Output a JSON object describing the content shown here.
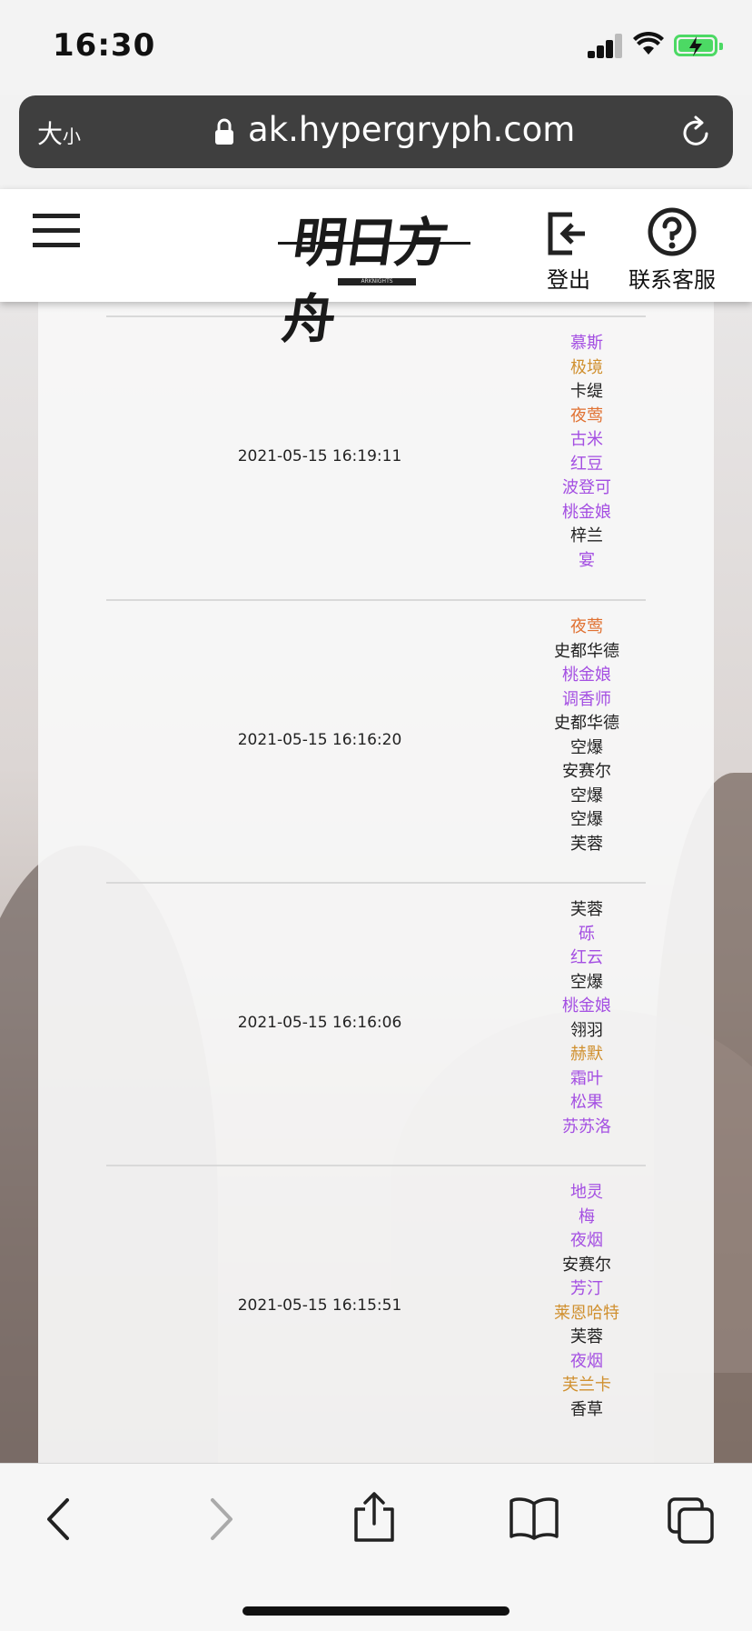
{
  "status_bar": {
    "time": "16:30"
  },
  "browser": {
    "text_size_label": "大",
    "text_size_small": "小",
    "url": "ak.hypergryph.com"
  },
  "header": {
    "logo_text": "明日方舟",
    "logo_sub": "ARKNIGHTS",
    "logout_label": "登出",
    "support_label": "联系客服"
  },
  "records": [
    {
      "time": "2021-05-15 16:19:11",
      "names": [
        {
          "text": "慕斯",
          "color": "#a44fe2"
        },
        {
          "text": "极境",
          "color": "#d0902f"
        },
        {
          "text": "卡缇",
          "color": "#222222"
        },
        {
          "text": "夜莺",
          "color": "#e07030"
        },
        {
          "text": "古米",
          "color": "#a44fe2"
        },
        {
          "text": "红豆",
          "color": "#a44fe2"
        },
        {
          "text": "波登可",
          "color": "#a44fe2"
        },
        {
          "text": "桃金娘",
          "color": "#a44fe2"
        },
        {
          "text": "梓兰",
          "color": "#222222"
        },
        {
          "text": "宴",
          "color": "#a44fe2"
        }
      ]
    },
    {
      "time": "2021-05-15 16:16:20",
      "names": [
        {
          "text": "夜莺",
          "color": "#e07030"
        },
        {
          "text": "史都华德",
          "color": "#222222"
        },
        {
          "text": "桃金娘",
          "color": "#a44fe2"
        },
        {
          "text": "调香师",
          "color": "#a44fe2"
        },
        {
          "text": "史都华德",
          "color": "#222222"
        },
        {
          "text": "空爆",
          "color": "#222222"
        },
        {
          "text": "安赛尔",
          "color": "#222222"
        },
        {
          "text": "空爆",
          "color": "#222222"
        },
        {
          "text": "空爆",
          "color": "#222222"
        },
        {
          "text": "芙蓉",
          "color": "#222222"
        }
      ]
    },
    {
      "time": "2021-05-15 16:16:06",
      "names": [
        {
          "text": "芙蓉",
          "color": "#222222"
        },
        {
          "text": "砾",
          "color": "#a44fe2"
        },
        {
          "text": "红云",
          "color": "#a44fe2"
        },
        {
          "text": "空爆",
          "color": "#222222"
        },
        {
          "text": "桃金娘",
          "color": "#a44fe2"
        },
        {
          "text": "翎羽",
          "color": "#222222"
        },
        {
          "text": "赫默",
          "color": "#d0902f"
        },
        {
          "text": "霜叶",
          "color": "#a44fe2"
        },
        {
          "text": "松果",
          "color": "#a44fe2"
        },
        {
          "text": "苏苏洛",
          "color": "#a44fe2"
        }
      ]
    },
    {
      "time": "2021-05-15 16:15:51",
      "names": [
        {
          "text": "地灵",
          "color": "#a44fe2"
        },
        {
          "text": "梅",
          "color": "#a44fe2"
        },
        {
          "text": "夜烟",
          "color": "#a44fe2"
        },
        {
          "text": "安赛尔",
          "color": "#222222"
        },
        {
          "text": "芳汀",
          "color": "#a44fe2"
        },
        {
          "text": "莱恩哈特",
          "color": "#d0902f"
        },
        {
          "text": "芙蓉",
          "color": "#222222"
        },
        {
          "text": "夜烟",
          "color": "#a44fe2"
        },
        {
          "text": "芙兰卡",
          "color": "#d0902f"
        },
        {
          "text": "香草",
          "color": "#222222"
        }
      ]
    }
  ]
}
